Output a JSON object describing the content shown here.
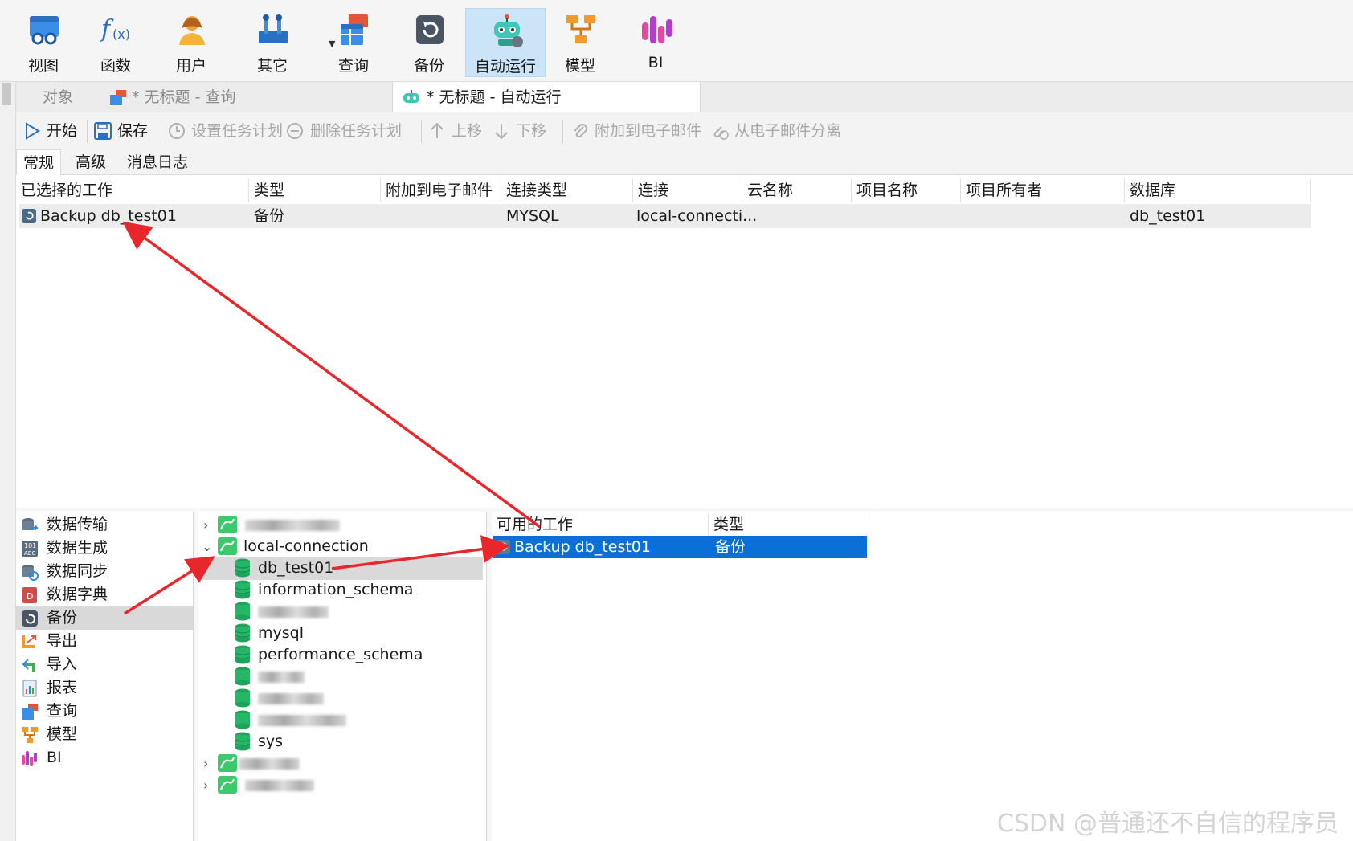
{
  "ribbon": {
    "items": [
      {
        "label": "视图",
        "icon": "view-icon"
      },
      {
        "label": "函数",
        "icon": "function-icon"
      },
      {
        "label": "用户",
        "icon": "user-icon"
      },
      {
        "label": "其它",
        "icon": "tools-icon"
      },
      {
        "label": "查询",
        "icon": "query-icon"
      },
      {
        "label": "备份",
        "icon": "backup-icon"
      },
      {
        "label": "自动运行",
        "icon": "robot-icon"
      },
      {
        "label": "模型",
        "icon": "model-icon"
      },
      {
        "label": "BI",
        "icon": "bi-icon"
      }
    ],
    "active": "自动运行"
  },
  "doc_tabs": {
    "objects": "对象",
    "query_tab": "* 无标题 - 查询",
    "automation_tab": "* 无标题 - 自动运行"
  },
  "toolbar": {
    "start": "开始",
    "save": "保存",
    "set_schedule": "设置任务计划",
    "delete_schedule": "删除任务计划",
    "move_up": "上移",
    "move_down": "下移",
    "attach_email": "附加到电子邮件",
    "detach_email": "从电子邮件分离"
  },
  "sub_tabs": {
    "general": "常规",
    "advanced": "高级",
    "message_log": "消息日志"
  },
  "selected_jobs": {
    "headers": {
      "job": "已选择的工作",
      "type": "类型",
      "email": "附加到电子邮件",
      "conn_type": "连接类型",
      "connection": "连接",
      "cloud": "云名称",
      "project": "项目名称",
      "owner": "项目所有者",
      "database": "数据库"
    },
    "rows": [
      {
        "job": "Backup db_test01",
        "type": "备份",
        "email": "",
        "conn_type": "MYSQL",
        "connection": "local-connecti...",
        "cloud": "",
        "project": "",
        "owner": "",
        "database": "db_test01"
      }
    ]
  },
  "categories": [
    {
      "label": "数据传输",
      "icon": "data-transfer-icon"
    },
    {
      "label": "数据生成",
      "icon": "data-generation-icon"
    },
    {
      "label": "数据同步",
      "icon": "data-sync-icon"
    },
    {
      "label": "数据字典",
      "icon": "data-dictionary-icon"
    },
    {
      "label": "备份",
      "icon": "backup-icon"
    },
    {
      "label": "导出",
      "icon": "export-icon"
    },
    {
      "label": "导入",
      "icon": "import-icon"
    },
    {
      "label": "报表",
      "icon": "report-icon"
    },
    {
      "label": "查询",
      "icon": "query-icon"
    },
    {
      "label": "模型",
      "icon": "model-icon"
    },
    {
      "label": "BI",
      "icon": "bi-icon"
    }
  ],
  "selected_category": "备份",
  "tree": {
    "connection": "local-connection",
    "databases": [
      "db_test01",
      "information_schema",
      "mysql",
      "performance_schema",
      "sys"
    ],
    "selected_database": "db_test01"
  },
  "available_jobs": {
    "headers": {
      "job": "可用的工作",
      "type": "类型"
    },
    "rows": [
      {
        "job": "Backup db_test01",
        "type": "备份"
      }
    ]
  },
  "watermark": "CSDN @普通还不自信的程序员",
  "colors": {
    "selection": "#0a6fd6",
    "annotation_arrow": "#e8272c",
    "mysql_green": "#3cc96b",
    "db_green": "#1ea35a"
  }
}
